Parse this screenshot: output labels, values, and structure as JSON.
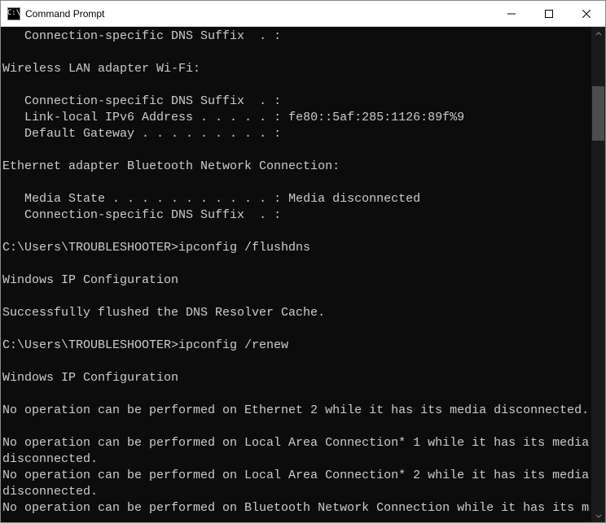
{
  "window": {
    "title": "Command Prompt",
    "icon_text": "C:\\"
  },
  "console": {
    "lines": [
      "   Connection-specific DNS Suffix  . :",
      "",
      "Wireless LAN adapter Wi-Fi:",
      "",
      "   Connection-specific DNS Suffix  . :",
      "   Link-local IPv6 Address . . . . . : fe80::5af:285:1126:89f%9",
      "   Default Gateway . . . . . . . . . :",
      "",
      "Ethernet adapter Bluetooth Network Connection:",
      "",
      "   Media State . . . . . . . . . . . : Media disconnected",
      "   Connection-specific DNS Suffix  . :",
      "",
      "C:\\Users\\TROUBLESHOOTER>ipconfig /flushdns",
      "",
      "Windows IP Configuration",
      "",
      "Successfully flushed the DNS Resolver Cache.",
      "",
      "C:\\Users\\TROUBLESHOOTER>ipconfig /renew",
      "",
      "Windows IP Configuration",
      "",
      "No operation can be performed on Ethernet 2 while it has its media disconnected.",
      "",
      "No operation can be performed on Local Area Connection* 1 while it has its media disconnected.",
      "No operation can be performed on Local Area Connection* 2 while it has its media disconnected.",
      "No operation can be performed on Bluetooth Network Connection while it has its m"
    ]
  },
  "scrollbar": {
    "thumb_top_pct": 12,
    "thumb_height_pct": 11
  }
}
